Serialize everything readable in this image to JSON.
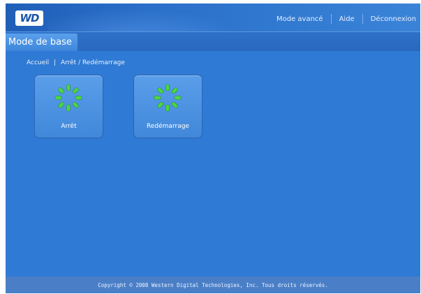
{
  "brand": {
    "logo_text": "WD"
  },
  "topnav": {
    "advanced_mode": "Mode avancé",
    "help": "Aide",
    "logout": "Déconnexion"
  },
  "tab": {
    "label": "Mode de base"
  },
  "breadcrumb": {
    "home": "Accueil",
    "separator": "|",
    "current": "Arrêt / Redémarrage"
  },
  "tiles": [
    {
      "label": "Arrêt",
      "icon": "spinner-icon"
    },
    {
      "label": "Redémarrage",
      "icon": "spinner-icon"
    }
  ],
  "footer": {
    "copyright": "Copyright © 2008 Western Digital Technologies, Inc. Tous droits réservés."
  },
  "colors": {
    "background": "#2f7ad4",
    "topbar": "#2a6fc9",
    "tile": "#4a92e2",
    "spinner": "#4cd64a",
    "footer": "#4a7fc7"
  }
}
